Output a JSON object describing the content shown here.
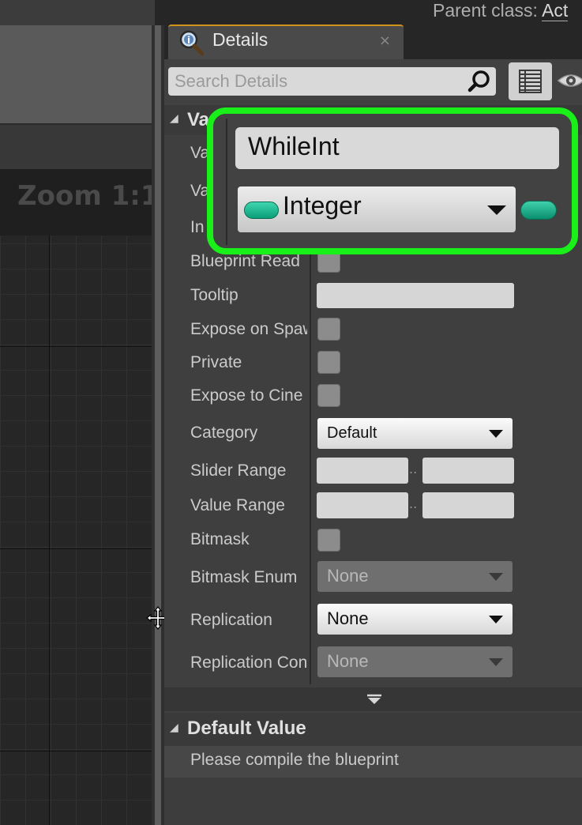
{
  "graph": {
    "zoom_label": "Zoom 1:1"
  },
  "top_bar": {
    "parent_class_label": "Parent class:",
    "parent_class_value": "Act"
  },
  "details_tab": {
    "title": "Details",
    "close_glyph": "×",
    "icon": "magnifier-icon"
  },
  "search": {
    "placeholder": "Search Details",
    "value": ""
  },
  "variable_section": {
    "title": "Va",
    "truncated_labels": [
      "Va",
      "Va",
      "In"
    ],
    "variable_name": "WhileInt",
    "variable_type": "Integer",
    "type_color": "#17b890"
  },
  "properties": {
    "blueprint_read": "Blueprint Read",
    "tooltip": "Tooltip",
    "expose_on_spawn": "Expose on Spaw",
    "private": "Private",
    "expose_to_cine": "Expose to Cine",
    "category": "Category",
    "category_value": "Default",
    "slider_range": "Slider Range",
    "value_range": "Value Range",
    "bitmask": "Bitmask",
    "bitmask_enum": "Bitmask Enum",
    "bitmask_enum_value": "None",
    "replication": "Replication",
    "replication_value": "None",
    "replication_condition": "Replication Con",
    "replication_condition_value": "None",
    "range_separator": ".."
  },
  "default_value_section": {
    "title": "Default Value",
    "message": "Please compile the blueprint"
  },
  "colors": {
    "highlight": "#19f019",
    "tab_accent": "#d09418"
  }
}
